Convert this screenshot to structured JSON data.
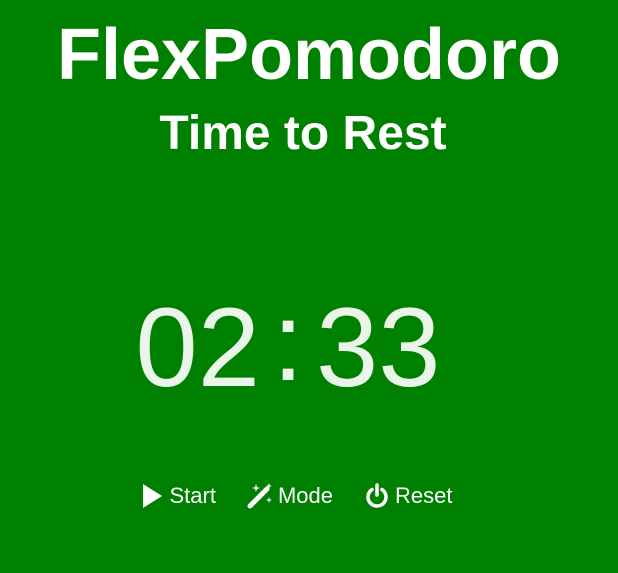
{
  "app": {
    "title": "FlexPomodoro",
    "subtitle": "Time to Rest"
  },
  "timer": {
    "minutes": "02",
    "separator": ":",
    "seconds": "33"
  },
  "controls": {
    "start_label": "Start",
    "mode_label": "Mode",
    "reset_label": "Reset",
    "start_icon": "play-icon",
    "mode_icon": "magic-wand-icon",
    "reset_icon": "power-icon"
  },
  "colors": {
    "background": "#008000",
    "text": "#ffffff",
    "timer_text": "#e8f5e8"
  }
}
